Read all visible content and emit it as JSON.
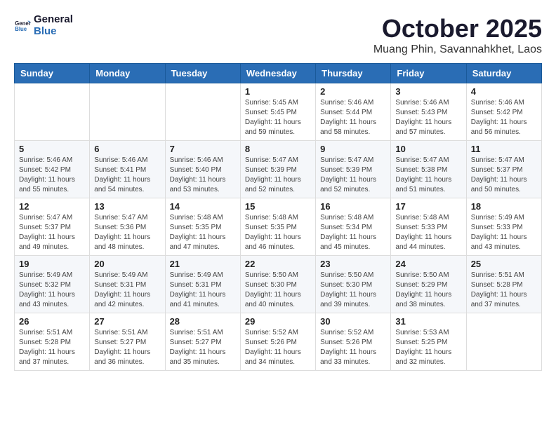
{
  "logo": {
    "line1": "General",
    "line2": "Blue"
  },
  "title": "October 2025",
  "location": "Muang Phin, Savannahkhet, Laos",
  "days_of_week": [
    "Sunday",
    "Monday",
    "Tuesday",
    "Wednesday",
    "Thursday",
    "Friday",
    "Saturday"
  ],
  "weeks": [
    [
      {
        "day": "",
        "sunrise": "",
        "sunset": "",
        "daylight": ""
      },
      {
        "day": "",
        "sunrise": "",
        "sunset": "",
        "daylight": ""
      },
      {
        "day": "",
        "sunrise": "",
        "sunset": "",
        "daylight": ""
      },
      {
        "day": "1",
        "sunrise": "Sunrise: 5:45 AM",
        "sunset": "Sunset: 5:45 PM",
        "daylight": "Daylight: 11 hours and 59 minutes."
      },
      {
        "day": "2",
        "sunrise": "Sunrise: 5:46 AM",
        "sunset": "Sunset: 5:44 PM",
        "daylight": "Daylight: 11 hours and 58 minutes."
      },
      {
        "day": "3",
        "sunrise": "Sunrise: 5:46 AM",
        "sunset": "Sunset: 5:43 PM",
        "daylight": "Daylight: 11 hours and 57 minutes."
      },
      {
        "day": "4",
        "sunrise": "Sunrise: 5:46 AM",
        "sunset": "Sunset: 5:42 PM",
        "daylight": "Daylight: 11 hours and 56 minutes."
      }
    ],
    [
      {
        "day": "5",
        "sunrise": "Sunrise: 5:46 AM",
        "sunset": "Sunset: 5:42 PM",
        "daylight": "Daylight: 11 hours and 55 minutes."
      },
      {
        "day": "6",
        "sunrise": "Sunrise: 5:46 AM",
        "sunset": "Sunset: 5:41 PM",
        "daylight": "Daylight: 11 hours and 54 minutes."
      },
      {
        "day": "7",
        "sunrise": "Sunrise: 5:46 AM",
        "sunset": "Sunset: 5:40 PM",
        "daylight": "Daylight: 11 hours and 53 minutes."
      },
      {
        "day": "8",
        "sunrise": "Sunrise: 5:47 AM",
        "sunset": "Sunset: 5:39 PM",
        "daylight": "Daylight: 11 hours and 52 minutes."
      },
      {
        "day": "9",
        "sunrise": "Sunrise: 5:47 AM",
        "sunset": "Sunset: 5:39 PM",
        "daylight": "Daylight: 11 hours and 52 minutes."
      },
      {
        "day": "10",
        "sunrise": "Sunrise: 5:47 AM",
        "sunset": "Sunset: 5:38 PM",
        "daylight": "Daylight: 11 hours and 51 minutes."
      },
      {
        "day": "11",
        "sunrise": "Sunrise: 5:47 AM",
        "sunset": "Sunset: 5:37 PM",
        "daylight": "Daylight: 11 hours and 50 minutes."
      }
    ],
    [
      {
        "day": "12",
        "sunrise": "Sunrise: 5:47 AM",
        "sunset": "Sunset: 5:37 PM",
        "daylight": "Daylight: 11 hours and 49 minutes."
      },
      {
        "day": "13",
        "sunrise": "Sunrise: 5:47 AM",
        "sunset": "Sunset: 5:36 PM",
        "daylight": "Daylight: 11 hours and 48 minutes."
      },
      {
        "day": "14",
        "sunrise": "Sunrise: 5:48 AM",
        "sunset": "Sunset: 5:35 PM",
        "daylight": "Daylight: 11 hours and 47 minutes."
      },
      {
        "day": "15",
        "sunrise": "Sunrise: 5:48 AM",
        "sunset": "Sunset: 5:35 PM",
        "daylight": "Daylight: 11 hours and 46 minutes."
      },
      {
        "day": "16",
        "sunrise": "Sunrise: 5:48 AM",
        "sunset": "Sunset: 5:34 PM",
        "daylight": "Daylight: 11 hours and 45 minutes."
      },
      {
        "day": "17",
        "sunrise": "Sunrise: 5:48 AM",
        "sunset": "Sunset: 5:33 PM",
        "daylight": "Daylight: 11 hours and 44 minutes."
      },
      {
        "day": "18",
        "sunrise": "Sunrise: 5:49 AM",
        "sunset": "Sunset: 5:33 PM",
        "daylight": "Daylight: 11 hours and 43 minutes."
      }
    ],
    [
      {
        "day": "19",
        "sunrise": "Sunrise: 5:49 AM",
        "sunset": "Sunset: 5:32 PM",
        "daylight": "Daylight: 11 hours and 43 minutes."
      },
      {
        "day": "20",
        "sunrise": "Sunrise: 5:49 AM",
        "sunset": "Sunset: 5:31 PM",
        "daylight": "Daylight: 11 hours and 42 minutes."
      },
      {
        "day": "21",
        "sunrise": "Sunrise: 5:49 AM",
        "sunset": "Sunset: 5:31 PM",
        "daylight": "Daylight: 11 hours and 41 minutes."
      },
      {
        "day": "22",
        "sunrise": "Sunrise: 5:50 AM",
        "sunset": "Sunset: 5:30 PM",
        "daylight": "Daylight: 11 hours and 40 minutes."
      },
      {
        "day": "23",
        "sunrise": "Sunrise: 5:50 AM",
        "sunset": "Sunset: 5:30 PM",
        "daylight": "Daylight: 11 hours and 39 minutes."
      },
      {
        "day": "24",
        "sunrise": "Sunrise: 5:50 AM",
        "sunset": "Sunset: 5:29 PM",
        "daylight": "Daylight: 11 hours and 38 minutes."
      },
      {
        "day": "25",
        "sunrise": "Sunrise: 5:51 AM",
        "sunset": "Sunset: 5:28 PM",
        "daylight": "Daylight: 11 hours and 37 minutes."
      }
    ],
    [
      {
        "day": "26",
        "sunrise": "Sunrise: 5:51 AM",
        "sunset": "Sunset: 5:28 PM",
        "daylight": "Daylight: 11 hours and 37 minutes."
      },
      {
        "day": "27",
        "sunrise": "Sunrise: 5:51 AM",
        "sunset": "Sunset: 5:27 PM",
        "daylight": "Daylight: 11 hours and 36 minutes."
      },
      {
        "day": "28",
        "sunrise": "Sunrise: 5:51 AM",
        "sunset": "Sunset: 5:27 PM",
        "daylight": "Daylight: 11 hours and 35 minutes."
      },
      {
        "day": "29",
        "sunrise": "Sunrise: 5:52 AM",
        "sunset": "Sunset: 5:26 PM",
        "daylight": "Daylight: 11 hours and 34 minutes."
      },
      {
        "day": "30",
        "sunrise": "Sunrise: 5:52 AM",
        "sunset": "Sunset: 5:26 PM",
        "daylight": "Daylight: 11 hours and 33 minutes."
      },
      {
        "day": "31",
        "sunrise": "Sunrise: 5:53 AM",
        "sunset": "Sunset: 5:25 PM",
        "daylight": "Daylight: 11 hours and 32 minutes."
      },
      {
        "day": "",
        "sunrise": "",
        "sunset": "",
        "daylight": ""
      }
    ]
  ]
}
